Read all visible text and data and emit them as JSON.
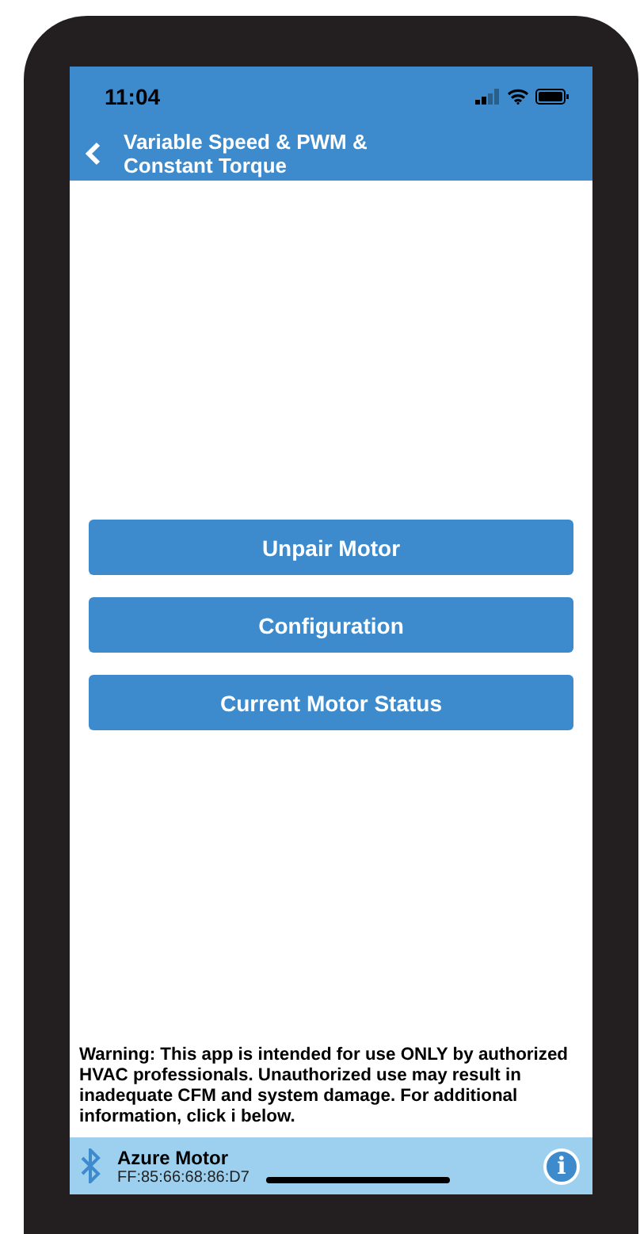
{
  "status_bar": {
    "time": "11:04"
  },
  "nav_bar": {
    "title": "Variable Speed & PWM & Constant Torque"
  },
  "buttons": [
    {
      "label": "Unpair Motor"
    },
    {
      "label": "Configuration"
    },
    {
      "label": "Current Motor Status"
    }
  ],
  "warning": "Warning: This app is intended for use ONLY by authorized HVAC professionals. Unauthorized use may result in inadequate CFM and system damage. For additional information, click i below.",
  "device_bar": {
    "name": "Azure Motor",
    "address": "FF:85:66:68:86:D7",
    "info_button": "i"
  }
}
